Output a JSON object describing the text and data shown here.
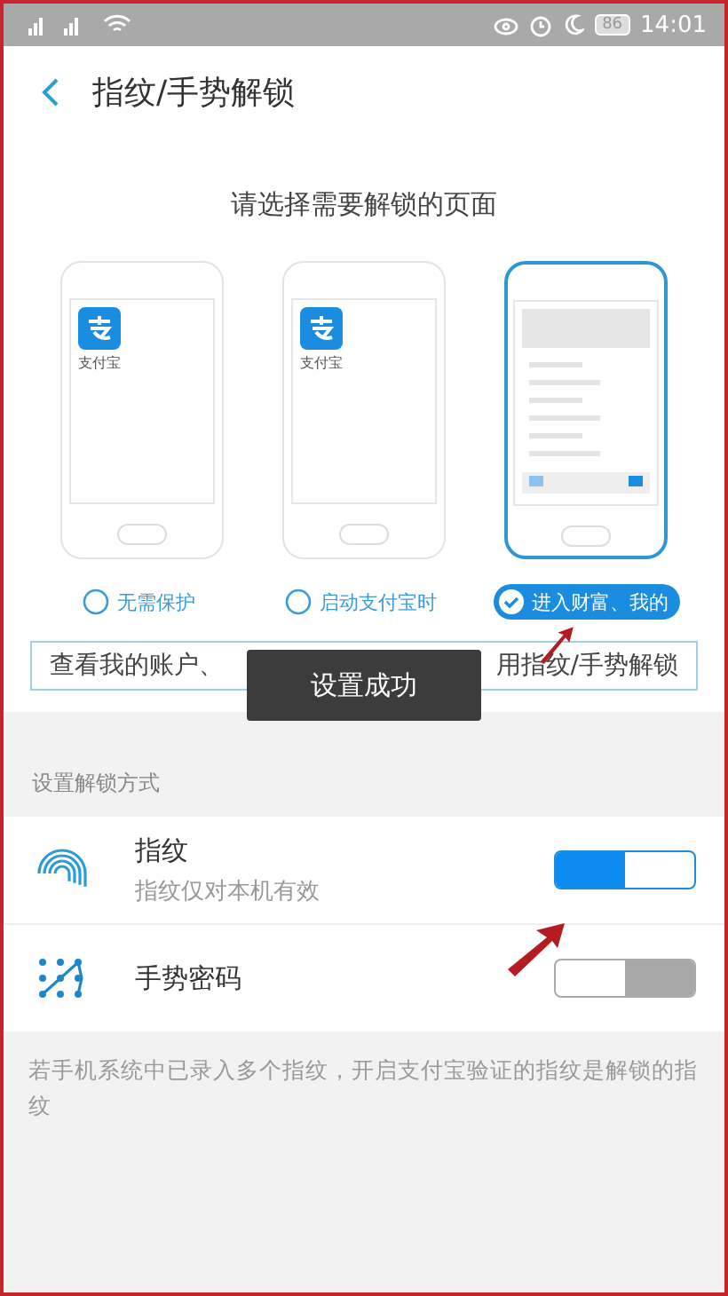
{
  "status_bar": {
    "battery": "86",
    "time": "14:01"
  },
  "header": {
    "title": "指纹/手势解锁"
  },
  "prompt": "请选择需要解锁的页面",
  "options": [
    {
      "kind": "blank",
      "app_label": "支付宝",
      "label": "无需保护",
      "selected": false
    },
    {
      "kind": "blank",
      "app_label": "支付宝",
      "label": "启动支付宝时",
      "selected": false
    },
    {
      "kind": "screen",
      "label": "进入财富、我的",
      "selected": true
    }
  ],
  "tip": {
    "left": "查看我的账户、",
    "right": "用指纹/手势解锁"
  },
  "toast": "设置成功",
  "section_title": "设置解锁方式",
  "methods": [
    {
      "kind": "fingerprint",
      "title": "指纹",
      "subtitle": "指纹仅对本机有效",
      "on": true
    },
    {
      "kind": "gesture",
      "title": "手势密码",
      "on": false
    }
  ],
  "footnote": "若手机系统中已录入多个指纹，开启支付宝验证的指纹是解锁的指纹"
}
